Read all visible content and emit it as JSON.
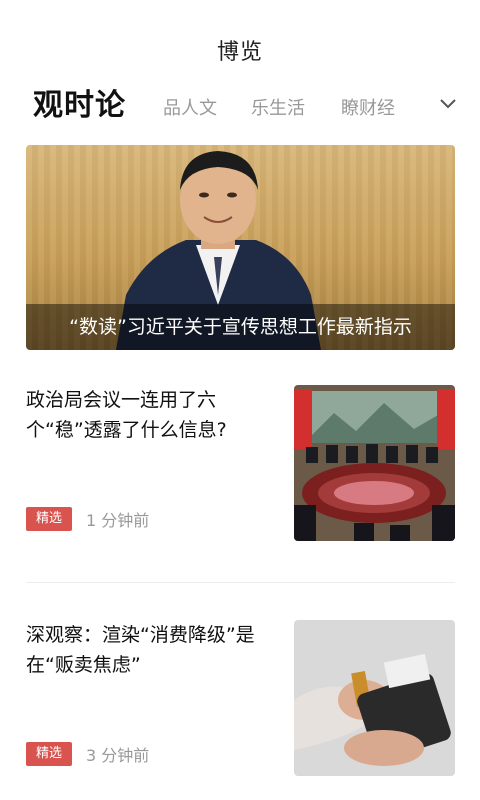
{
  "app": {
    "title": "博览"
  },
  "tabs": [
    {
      "label": "观时论",
      "active": true
    },
    {
      "label": "品人文",
      "active": false
    },
    {
      "label": "乐生活",
      "active": false
    },
    {
      "label": "瞭财经",
      "active": false
    }
  ],
  "tabs_more_icon": "chevron-down-icon",
  "hero": {
    "caption": "“数读”习近平关于宣传思想工作最新指示"
  },
  "articles": [
    {
      "title": "政治局会议一连用了六个“稳”透露了什么信息?",
      "badge": "精选",
      "time": "1 分钟前"
    },
    {
      "title": "深观察：渲染“消费降级”是在“贩卖焦虑”",
      "badge": "精选",
      "time": "3 分钟前"
    }
  ],
  "colors": {
    "badge": "#d9534f",
    "active_tab": "#111111",
    "inactive_tab": "#999999"
  }
}
